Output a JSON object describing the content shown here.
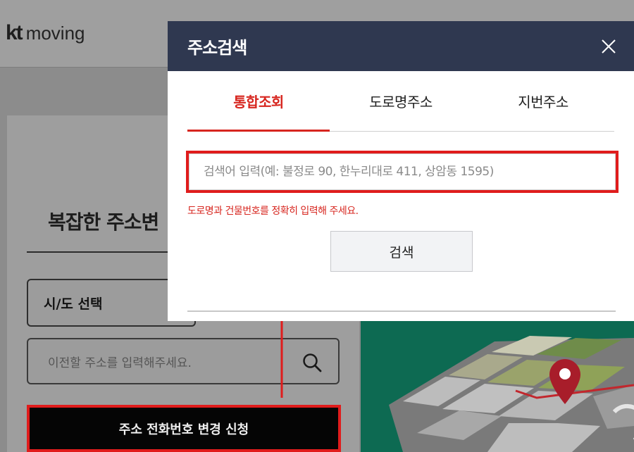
{
  "background": {
    "logo": {
      "brand": "kt",
      "name": "moving"
    },
    "title": "복잡한 주소변",
    "sido_select": "시/도 선택",
    "address_placeholder": "이전할 주소를 입력해주세요.",
    "apply_button": "주소 전화번호 변경 신청"
  },
  "modal": {
    "title": "주소검색",
    "close_icon": "close-icon",
    "tabs": [
      {
        "label": "통합조회",
        "active": true
      },
      {
        "label": "도로명주소",
        "active": false
      },
      {
        "label": "지번주소",
        "active": false
      }
    ],
    "search_placeholder": "검색어 입력(예: 불정로 90, 한누리대로 411, 상암동 1595)",
    "hint": "도로명과 건물번호를 정확히 입력해 주세요.",
    "search_button": "검색"
  },
  "colors": {
    "modal_header": "#2f3850",
    "accent_red": "#d7261f",
    "highlight_red": "#e01c1c",
    "map_green": "#0d6a52"
  }
}
